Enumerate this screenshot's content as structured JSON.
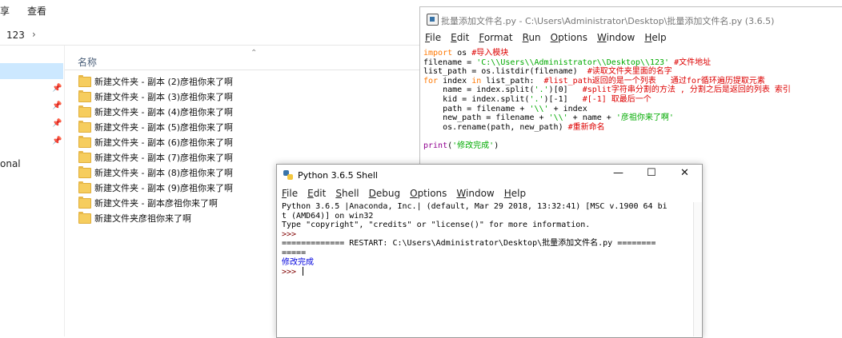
{
  "explorer": {
    "menu": [
      "享",
      "查看"
    ],
    "address": "123",
    "nav_label": "onal",
    "column_name": "名称",
    "files": [
      "新建文件夹 - 副本 (2)彦祖你来了啊",
      "新建文件夹 - 副本 (3)彦祖你来了啊",
      "新建文件夹 - 副本 (4)彦祖你来了啊",
      "新建文件夹 - 副本 (5)彦祖你来了啊",
      "新建文件夹 - 副本 (6)彦祖你来了啊",
      "新建文件夹 - 副本 (7)彦祖你来了啊",
      "新建文件夹 - 副本 (8)彦祖你来了啊",
      "新建文件夹 - 副本 (9)彦祖你来了啊",
      "新建文件夹 - 副本彦祖你来了啊",
      "新建文件夹彦祖你来了啊"
    ]
  },
  "editor": {
    "title": "批量添加文件名.py - C:\\Users\\Administrator\\Desktop\\批量添加文件名.py (3.6.5)",
    "menu": [
      "File",
      "Edit",
      "Format",
      "Run",
      "Options",
      "Window",
      "Help"
    ],
    "code_lines": [
      [
        {
          "t": "import",
          "c": "kw"
        },
        {
          "t": " os "
        },
        {
          "t": "#导入模块",
          "c": "cmt"
        }
      ],
      [
        {
          "t": "filename = "
        },
        {
          "t": "'C:\\\\Users\\\\Administrator\\\\Desktop\\\\123'",
          "c": "str"
        },
        {
          "t": " "
        },
        {
          "t": "#文件地址",
          "c": "cmt"
        }
      ],
      [
        {
          "t": "list_path = os.listdir(filename)  "
        },
        {
          "t": "#读取文件夹里面的名字",
          "c": "cmt"
        }
      ],
      [
        {
          "t": "for",
          "c": "kw"
        },
        {
          "t": " index "
        },
        {
          "t": "in",
          "c": "kw"
        },
        {
          "t": " list_path:  "
        },
        {
          "t": "#list_path返回的是一个列表   通过for循环遍历提取元素",
          "c": "cmt"
        }
      ],
      [
        {
          "t": "    name = index.split("
        },
        {
          "t": "'.'",
          "c": "str"
        },
        {
          "t": ")[0]   "
        },
        {
          "t": "#split字符串分割的方法 , 分割之后是返回的列表 索引",
          "c": "cmt"
        }
      ],
      [
        {
          "t": "    kid = index.split("
        },
        {
          "t": "'.'",
          "c": "str"
        },
        {
          "t": ")[-1]   "
        },
        {
          "t": "#[-1] 取最后一个",
          "c": "cmt"
        }
      ],
      [
        {
          "t": "    path = filename + "
        },
        {
          "t": "'\\\\'",
          "c": "str"
        },
        {
          "t": " + index"
        }
      ],
      [
        {
          "t": "    new_path = filename + "
        },
        {
          "t": "'\\\\'",
          "c": "str"
        },
        {
          "t": " + name + "
        },
        {
          "t": "'彦祖你来了啊'",
          "c": "str"
        }
      ],
      [
        {
          "t": "    os.rename(path, new_path) "
        },
        {
          "t": "#重新命名",
          "c": "cmt"
        }
      ],
      [
        {
          "t": ""
        }
      ],
      [
        {
          "t": "print",
          "c": "bi"
        },
        {
          "t": "("
        },
        {
          "t": "'修改完成'",
          "c": "str"
        },
        {
          "t": ")"
        }
      ]
    ]
  },
  "shell": {
    "title": "Python 3.6.5 Shell",
    "minimize": "—",
    "maximize": "☐",
    "close": "✕",
    "menu": [
      "File",
      "Edit",
      "Shell",
      "Debug",
      "Options",
      "Window",
      "Help"
    ],
    "line1": "Python 3.6.5 |Anaconda, Inc.| (default, Mar 29 2018, 13:32:41) [MSC v.1900 64 bi",
    "line2": "t (AMD64)] on win32",
    "line3": "Type \"copyright\", \"credits\" or \"license()\" for more information.",
    "prompt1": ">>> ",
    "restart1": "============= RESTART: C:\\Users\\Administrator\\Desktop\\批量添加文件名.py ========",
    "restart2": "=====",
    "output": "修改完成",
    "prompt2": ">>> "
  }
}
